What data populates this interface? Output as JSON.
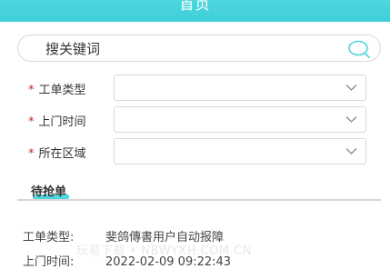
{
  "header": {
    "title": "首页"
  },
  "search": {
    "placeholder": "搜关键词"
  },
  "form": {
    "required_mark": "*",
    "fields": [
      {
        "label": "工单类型",
        "value": ""
      },
      {
        "label": "上门时间",
        "value": ""
      },
      {
        "label": "所在区域",
        "value": ""
      }
    ]
  },
  "section": {
    "title": "待抢单"
  },
  "order": {
    "type_label": "工单类型:",
    "type_value": "斐鸽傳書用户自动报障",
    "time_label": "上门时间:",
    "time_value": "2022-02-09 09:22:43"
  },
  "watermark": "玩易下载 • NBWYXH.COM.CN",
  "colors": {
    "accent": "#4fd6de",
    "required": "#e02020"
  }
}
